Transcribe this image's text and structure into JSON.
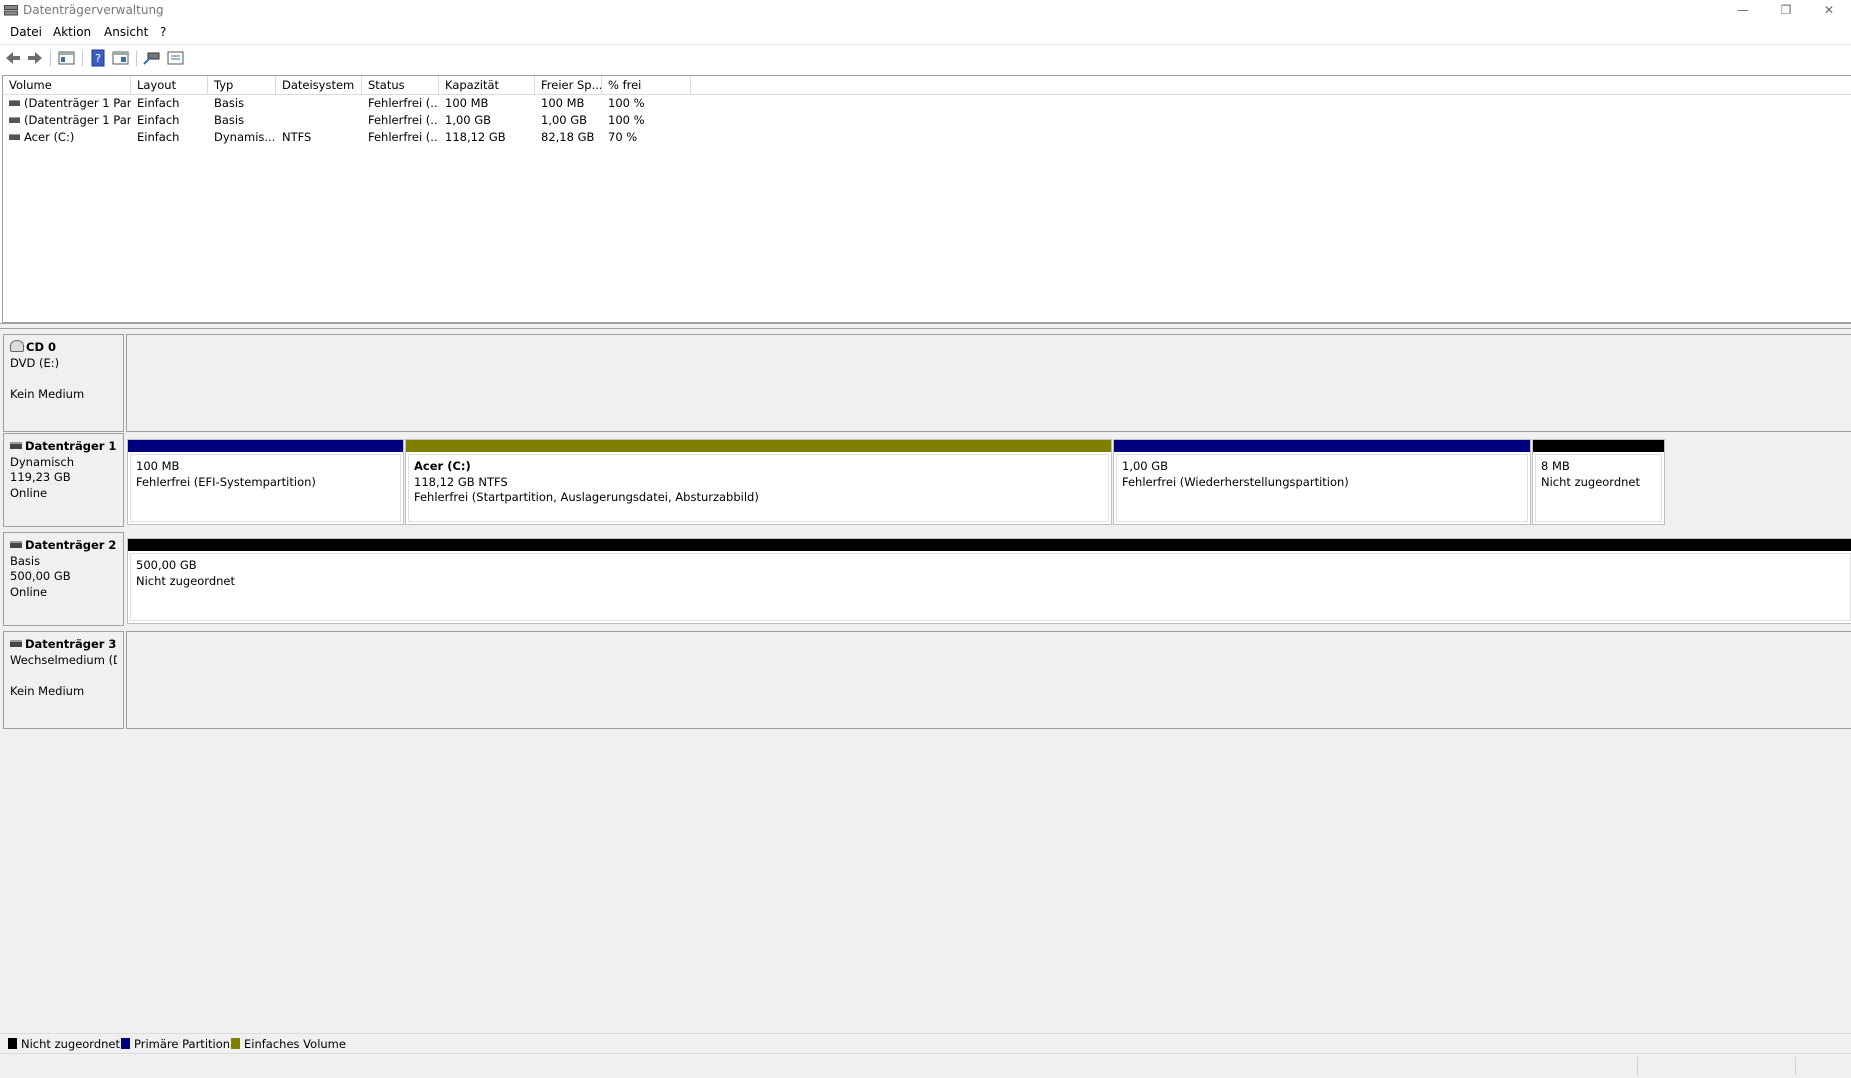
{
  "window": {
    "title": "Datenträgerverwaltung",
    "minimize_glyph": "—",
    "restore_glyph": "❐",
    "close_glyph": "✕"
  },
  "menu": [
    "Datei",
    "Aktion",
    "Ansicht",
    "?"
  ],
  "toolbar": {
    "buttons": [
      "back-arrow-icon",
      "forward-arrow-icon",
      "console-tree-icon",
      "help-icon",
      "properties-pane-icon",
      "connect-icon",
      "properties-icon"
    ]
  },
  "volume_list": {
    "columns": [
      "Volume",
      "Layout",
      "Typ",
      "Dateisystem",
      "Status",
      "Kapazität",
      "Freier Sp...",
      "% frei"
    ],
    "rows": [
      [
        "(Datenträger 1 Par...",
        "Einfach",
        "Basis",
        "",
        "Fehlerfrei (...",
        "100 MB",
        "100 MB",
        "100 %"
      ],
      [
        "(Datenträger 1 Par...",
        "Einfach",
        "Basis",
        "",
        "Fehlerfrei (...",
        "1,00 GB",
        "1,00 GB",
        "100 %"
      ],
      [
        "Acer (C:)",
        "Einfach",
        "Dynamis...",
        "NTFS",
        "Fehlerfrei (...",
        "118,12 GB",
        "82,18 GB",
        "70 %"
      ]
    ]
  },
  "disks": [
    {
      "name": "CD 0",
      "lines": [
        "DVD (E:)",
        "",
        "Kein Medium"
      ],
      "partitions": []
    },
    {
      "name": "Datenträger 1",
      "lines": [
        "Dynamisch",
        "119,23 GB",
        "Online"
      ],
      "partitions": [
        {
          "title": "",
          "size": "100 MB",
          "status": "Fehlerfrei (EFI-Systempartition)",
          "color": "#00007f"
        },
        {
          "title": "Acer  (C:)",
          "size": "118,12 GB NTFS",
          "status": "Fehlerfrei (Startpartition, Auslagerungsdatei, Absturzabbild)",
          "color": "#7f7f00"
        },
        {
          "title": "",
          "size": "1,00 GB",
          "status": "Fehlerfrei (Wiederherstellungspartition)",
          "color": "#00007f"
        },
        {
          "title": "",
          "size": "8 MB",
          "status": "Nicht zugeordnet",
          "color": "#000000"
        }
      ]
    },
    {
      "name": "Datenträger 2",
      "lines": [
        "Basis",
        "500,00 GB",
        "Online"
      ],
      "partitions": [
        {
          "title": "",
          "size": "500,00 GB",
          "status": "Nicht zugeordnet",
          "color": "#000000"
        }
      ]
    },
    {
      "name": "Datenträger 3",
      "lines": [
        "Wechselmedium (D:",
        "",
        "Kein Medium"
      ],
      "partitions": []
    }
  ],
  "legend": [
    {
      "label": "Nicht zugeordnet",
      "color": "#000000"
    },
    {
      "label": "Primäre Partition",
      "color": "#00007f"
    },
    {
      "label": "Einfaches Volume",
      "color": "#7f7f00"
    }
  ]
}
